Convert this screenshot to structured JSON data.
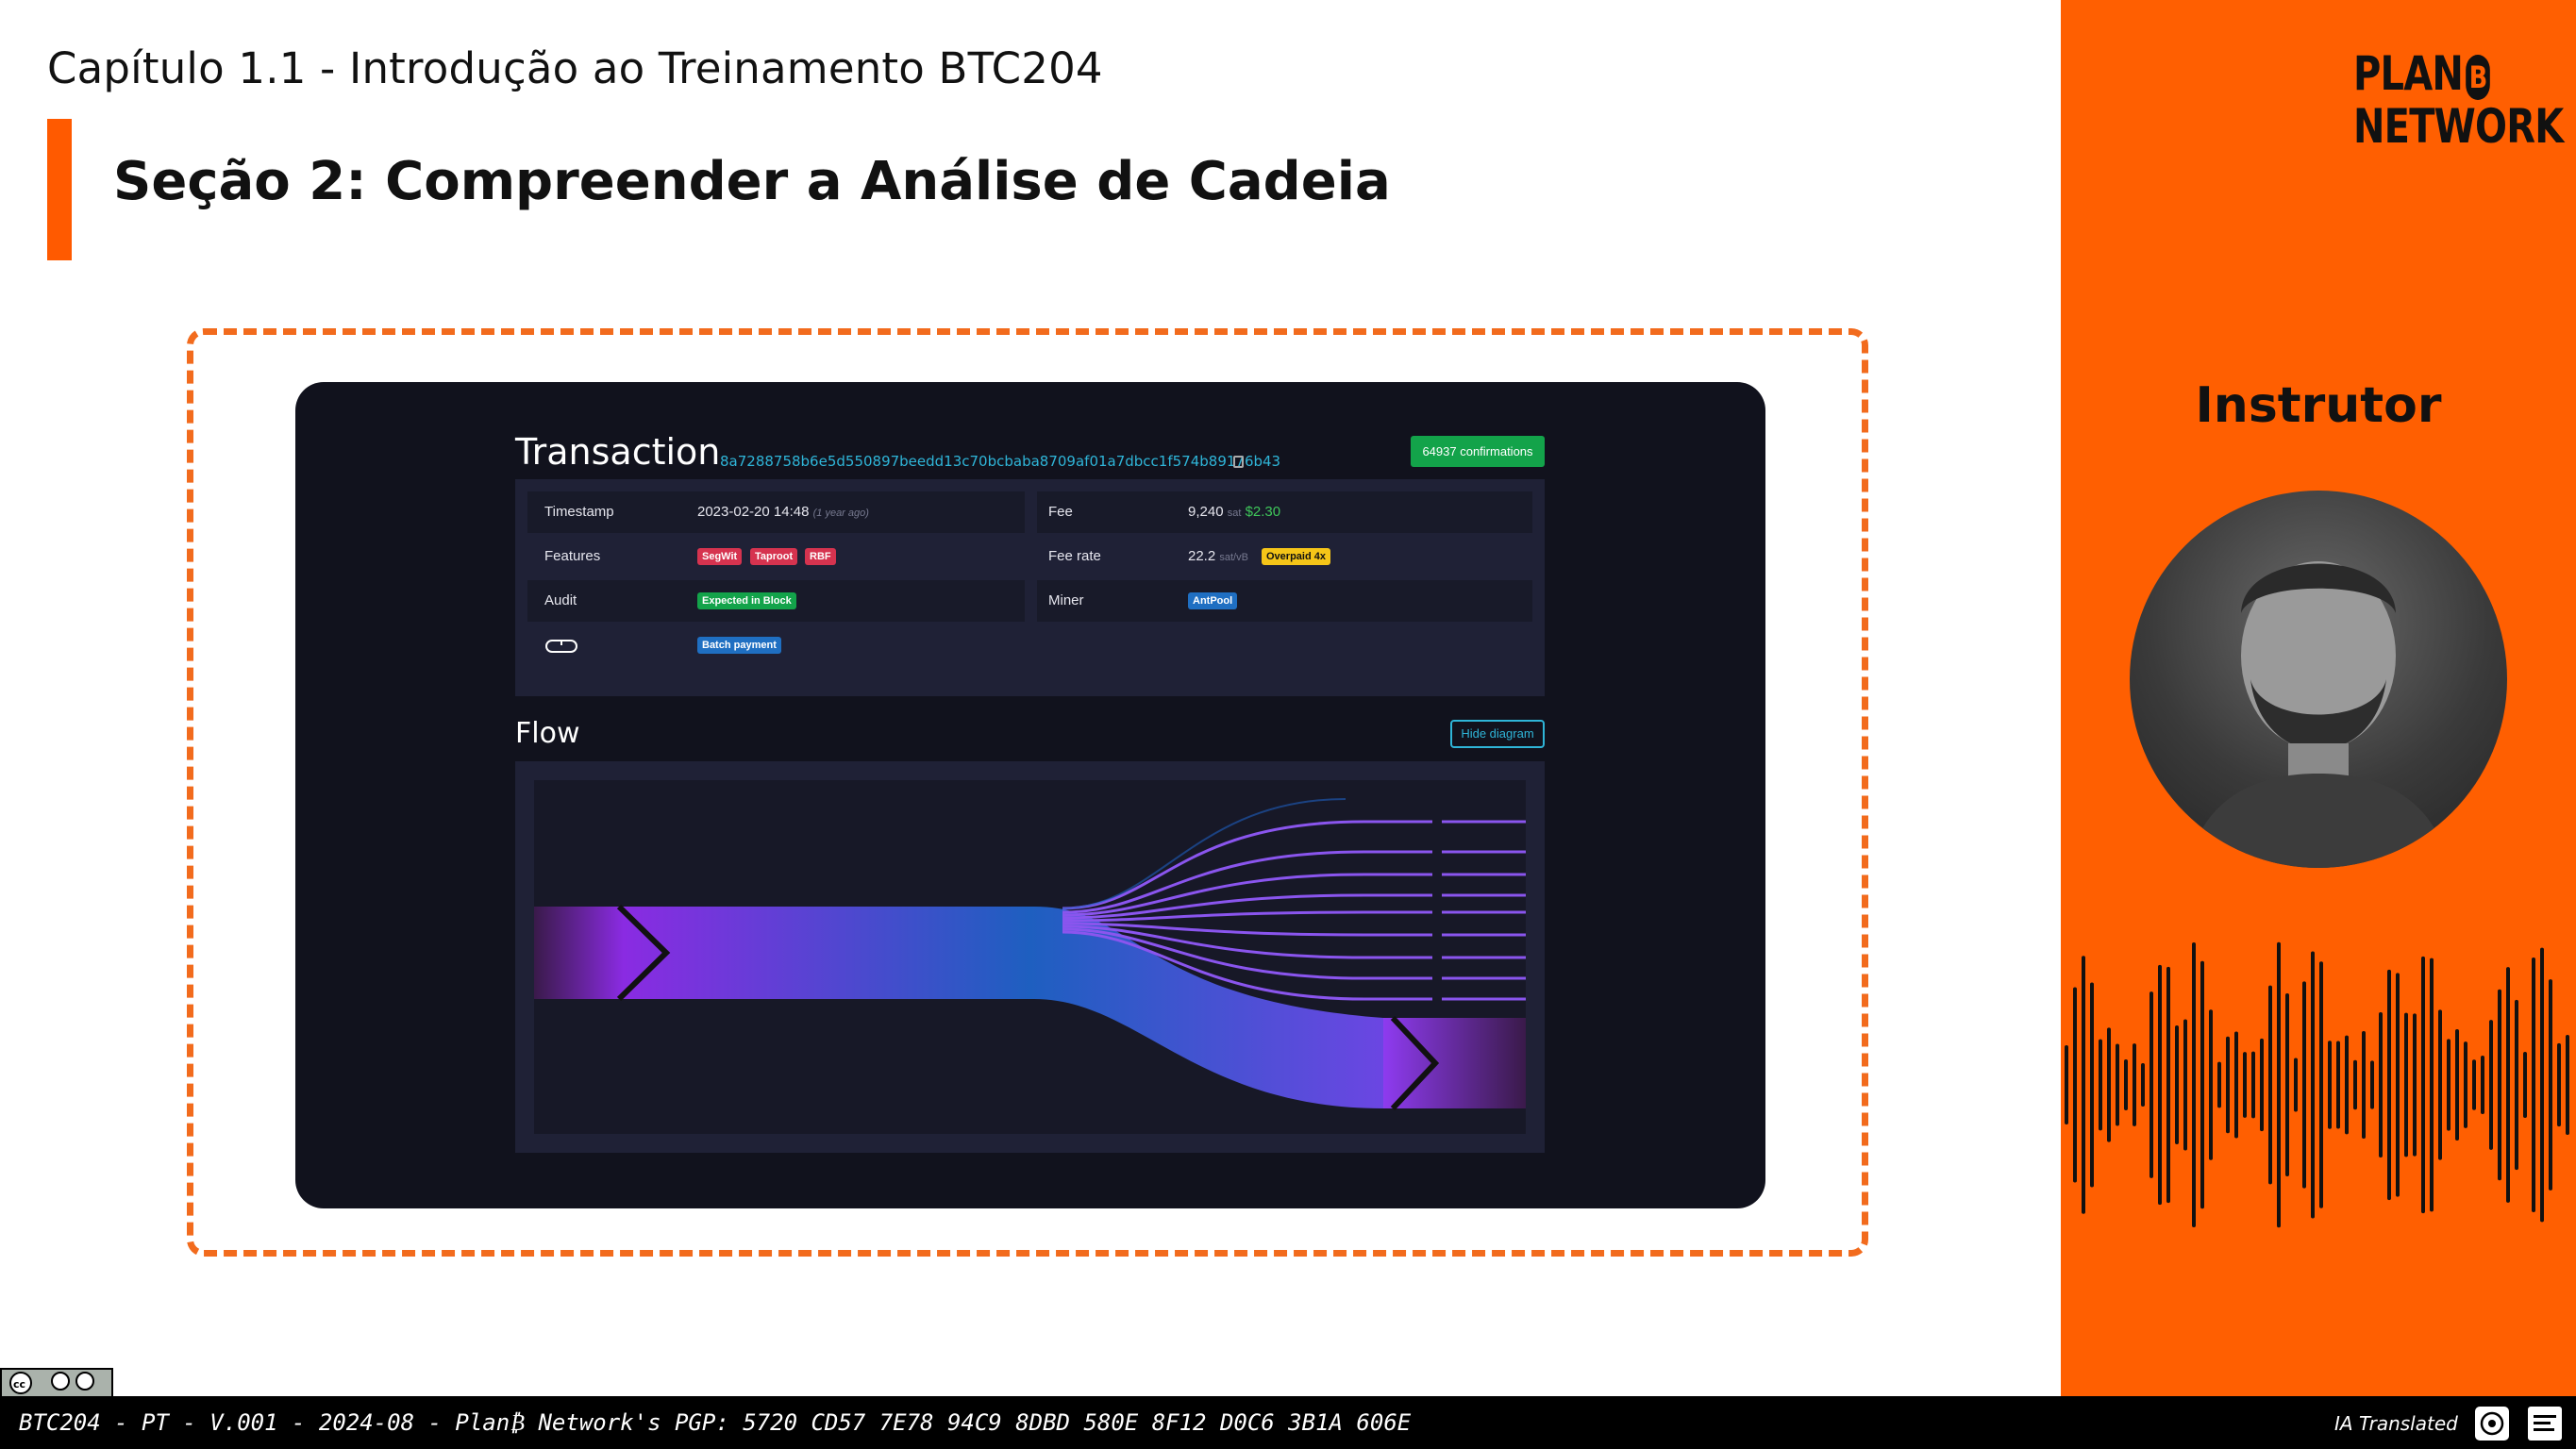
{
  "header": {
    "chapter": "Capítulo 1.1 - Introdução ao Treinamento BTC204",
    "section": "Seção 2: Compreender a Análise de Cadeia"
  },
  "transaction": {
    "title": "Transaction",
    "hash": "8a7288758b6e5d550897beedd13c70bcbaba8709af01a7dbcc1f574b89176b43",
    "confirmations": "64937 confirmations",
    "timestamp_label": "Timestamp",
    "timestamp_value": "2023-02-20 14:48",
    "timestamp_ago": "(1 year ago)",
    "features_label": "Features",
    "features": [
      "SegWit",
      "Taproot",
      "RBF"
    ],
    "audit_label": "Audit",
    "audit_badge": "Expected in Block",
    "batch_badge": "Batch payment",
    "fee_label": "Fee",
    "fee_value": "9,240",
    "fee_unit": "sat",
    "fee_usd": "$2.30",
    "fee_rate_label": "Fee rate",
    "fee_rate_value": "22.2",
    "fee_rate_unit": "sat/vB",
    "overpaid_badge": "Overpaid 4x",
    "miner_label": "Miner",
    "miner_badge": "AntPool"
  },
  "flow": {
    "title": "Flow",
    "hide_button": "Hide diagram"
  },
  "sidebar": {
    "logo_line1": "PLAN",
    "logo_b": "B",
    "logo_line2": "NETWORK",
    "instructor_label": "Instrutor"
  },
  "footer": {
    "text": "BTC204 - PT - V.001 - 2024-08 - Plan₿ Network's PGP: 5720 CD57 7E78 94C9 8DBD 580E 8F12 D0C6 3B1A 606E",
    "right": "IA Translated",
    "cc_label": "cc BY SA"
  },
  "colors": {
    "accent": "#ff5f01",
    "frame": "#f26b1d",
    "segwit": "#d6334f",
    "audit": "#13a34a",
    "miner": "#1f6fc2",
    "overpaid": "#f5c518"
  }
}
